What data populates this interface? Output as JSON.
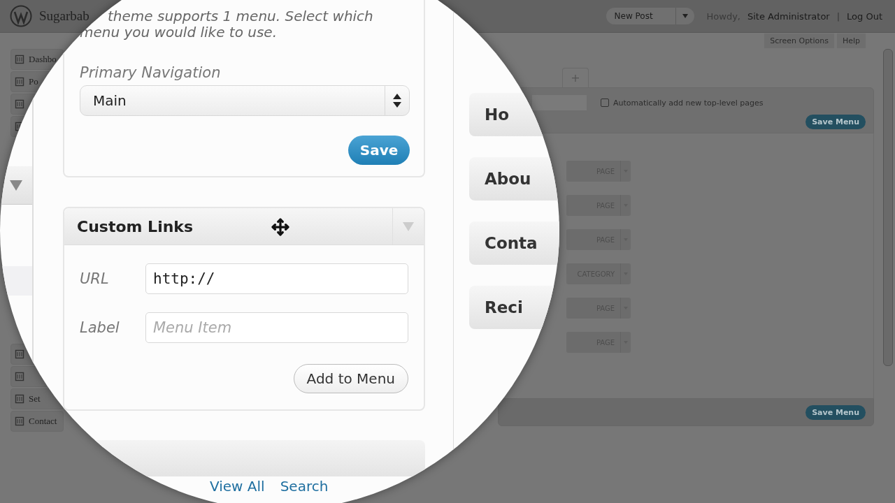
{
  "admin_bar": {
    "site_title": "Sugarbab",
    "new_post": "New Post",
    "greeting": "Howdy,",
    "user": "Site Administrator",
    "separator": "|",
    "logout": "Log Out"
  },
  "screen_tabs": [
    "Screen Options",
    "Help"
  ],
  "sidebar": {
    "items": [
      {
        "label": "Dashbo",
        "kind": "text"
      },
      {
        "label": "Po",
        "kind": "text"
      },
      {
        "kind": "icon"
      },
      {
        "kind": "icon"
      },
      {
        "kind": "gap"
      },
      {
        "kind": "icon"
      },
      {
        "kind": "icon"
      },
      {
        "label": "Set",
        "kind": "text"
      },
      {
        "label": "Contact",
        "kind": "text"
      }
    ]
  },
  "menu_editor": {
    "add_tab": "+",
    "auto_add": {
      "label": "Automatically add new top-level pages",
      "checked": false
    },
    "save": "Save Menu",
    "items": [
      {
        "type": "PAGE"
      },
      {
        "type": "PAGE"
      },
      {
        "type": "PAGE"
      },
      {
        "type": "CATEGORY"
      },
      {
        "type": "PAGE"
      },
      {
        "type": "PAGE"
      }
    ],
    "footer_save": "Save Menu"
  },
  "magnifier": {
    "intro": [
      "theme supports 1 menu. Select which",
      "menu you would like to use."
    ],
    "location_label": "Primary Navigation",
    "location_value": "Main",
    "save": "Save",
    "custom_links": {
      "title": "Custom Links",
      "url_label": "URL",
      "url_value": "http://",
      "label_label": "Label",
      "label_placeholder": "Menu Item",
      "add": "Add to Menu"
    },
    "links": [
      "View All",
      "Search"
    ],
    "menu_items": [
      "Ho",
      "Abou",
      "Conta",
      "Reci"
    ]
  }
}
